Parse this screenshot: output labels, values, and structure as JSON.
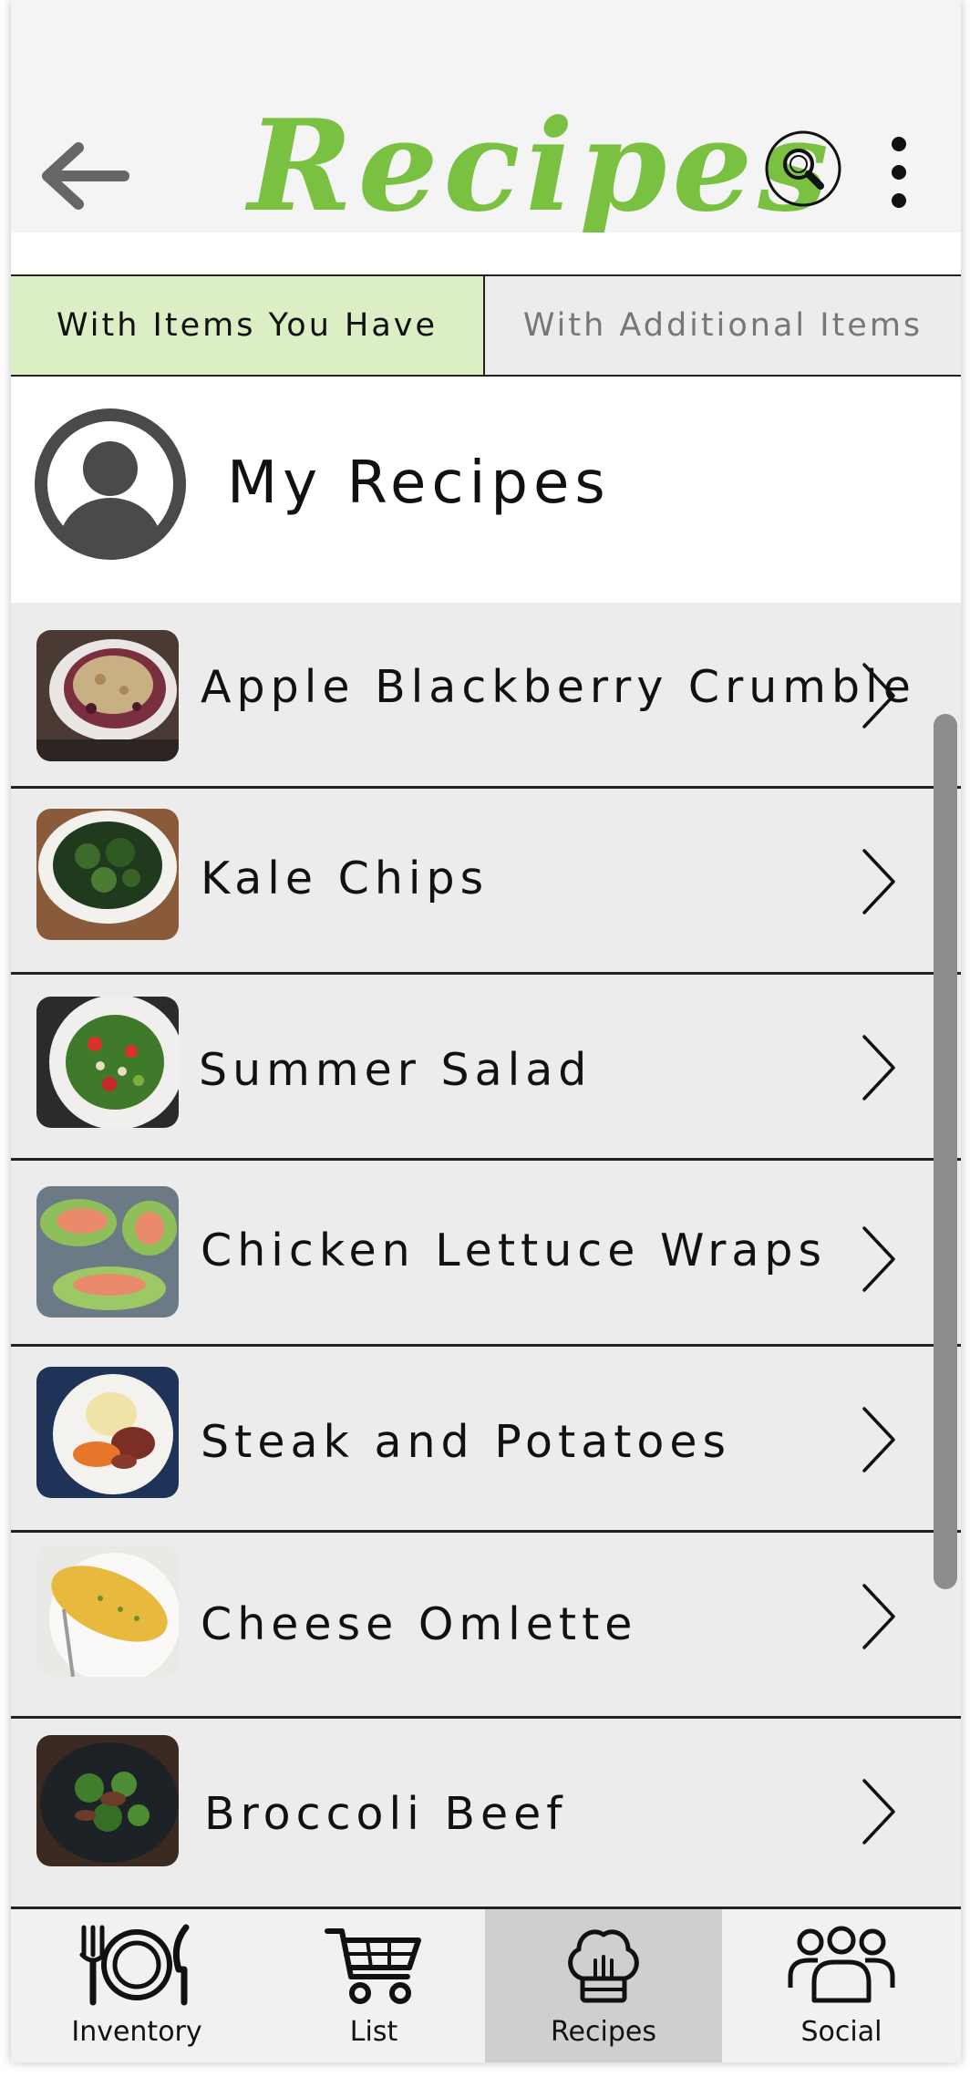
{
  "header": {
    "title": "Recipes",
    "back_icon": "arrow-left-icon",
    "search_icon": "search-icon",
    "more_icon": "more-vertical-icon"
  },
  "tabs": [
    {
      "label": "With Items You Have",
      "active": true
    },
    {
      "label": "With Additional Items",
      "active": false
    }
  ],
  "my_recipes": {
    "label": "My Recipes",
    "icon": "user-avatar-icon"
  },
  "recipes": [
    {
      "name": "Apple Blackberry Crumble"
    },
    {
      "name": "Kale Chips"
    },
    {
      "name": "Summer Salad"
    },
    {
      "name": "Chicken Lettuce Wraps"
    },
    {
      "name": "Steak and Potatoes"
    },
    {
      "name": "Cheese Omlette"
    },
    {
      "name": "Broccoli Beef"
    }
  ],
  "bottom_nav": [
    {
      "label": "Inventory",
      "icon": "plate-utensils-icon",
      "active": false
    },
    {
      "label": "List",
      "icon": "shopping-cart-icon",
      "active": false
    },
    {
      "label": "Recipes",
      "icon": "chef-hat-icon",
      "active": true
    },
    {
      "label": "Social",
      "icon": "group-icon",
      "active": false
    }
  ],
  "colors": {
    "brand_green": "#7ac142",
    "active_tab_bg": "#dcefc4",
    "list_bg": "#ececec",
    "active_nav_bg": "#cfcfcf"
  }
}
